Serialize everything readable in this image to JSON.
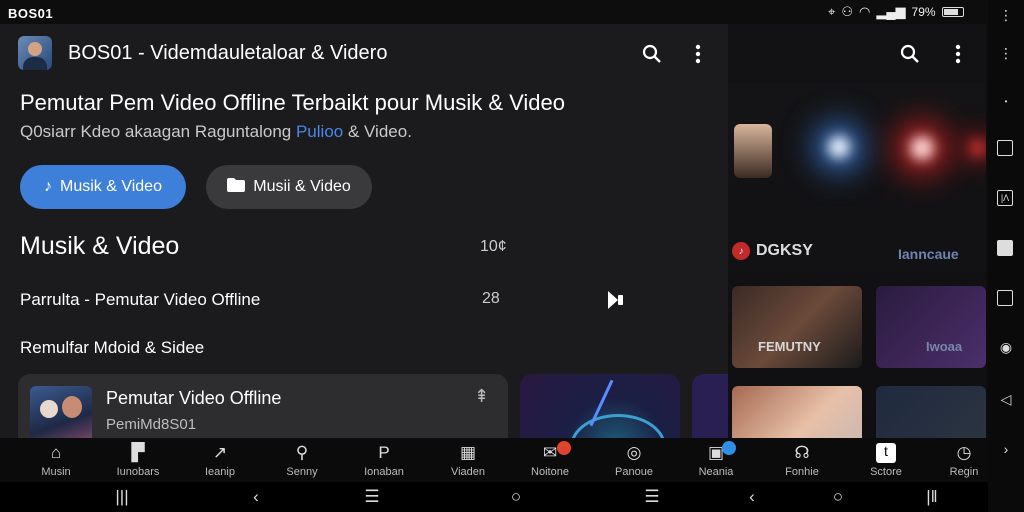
{
  "status_bar": {
    "time": "BOS01",
    "battery_text": "79%"
  },
  "app_bar": {
    "title": "BOS01 - Videmdauletaloar & Videro",
    "search_icon": "search-icon",
    "menu_icon": "more-vert-icon"
  },
  "hero": {
    "title": "Pemutar Pem Video Offline Terbaikt pour Musik & Video",
    "subtitle_prefix": "Q0siarr Kdeo akaagan Raguntalong ",
    "subtitle_accent": "Pulioo",
    "subtitle_suffix": " & Video."
  },
  "buttons": {
    "primary": "Musik & Video",
    "secondary": "Musii & Video"
  },
  "section": {
    "title": "Musik & Video",
    "count": "10¢",
    "row_label": "Parrulta - Pemutar Video Offline",
    "row_count": "28",
    "sub_label": "Remulfar Mdoid & Sidee"
  },
  "card": {
    "title": "Pemutar Video Offline",
    "subtitle": "PemiMd8S01",
    "action_icon": "pin-icon"
  },
  "right_pane": {
    "logo_text": "DGKSY",
    "tag": "Ianncaue",
    "tile_1_label": "FEMUTNY",
    "tile_2_label": "Iwoaa"
  },
  "bottom_nav": [
    {
      "label": "Musin",
      "icon": "home-icon"
    },
    {
      "label": "Iunobars",
      "icon": "grid-icon"
    },
    {
      "label": "Ieanip",
      "icon": "share-icon"
    },
    {
      "label": "Senny",
      "icon": "search-icon"
    },
    {
      "label": "Ionaban",
      "icon": "label-icon"
    },
    {
      "label": "Viaden",
      "icon": "grid-icon"
    },
    {
      "label": "Noitone",
      "icon": "mail-icon",
      "badge": ""
    },
    {
      "label": "Panoue",
      "icon": "compass-icon"
    },
    {
      "label": "Neania",
      "icon": "grid-icon",
      "badge": ""
    },
    {
      "label": "Fonhie",
      "icon": "headphones-icon"
    },
    {
      "label": "Sctore",
      "icon": "text-icon"
    },
    {
      "label": "Regin",
      "icon": "clock-icon"
    }
  ],
  "colors": {
    "accent": "#3d7fd9",
    "badge_red": "#e0432e",
    "badge_blue": "#2f8fe6"
  }
}
